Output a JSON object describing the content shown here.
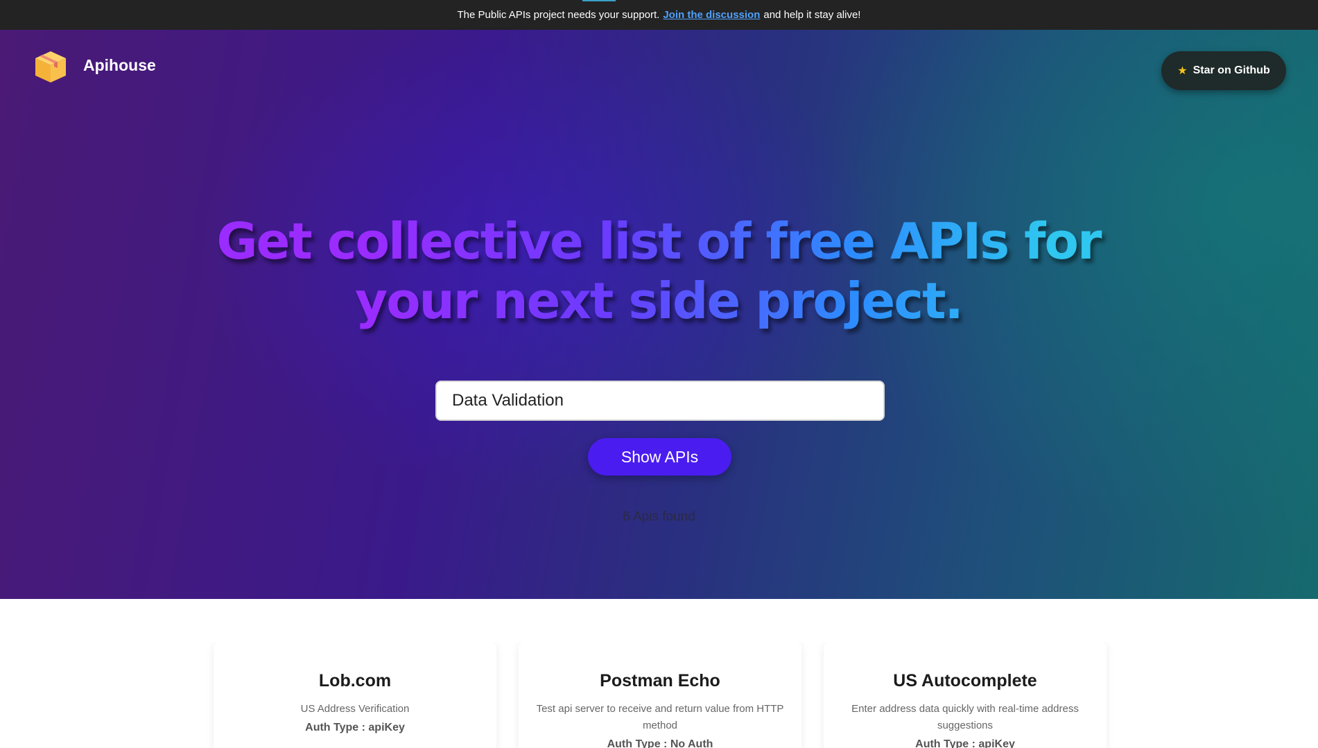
{
  "banner": {
    "text_before": "The Public APIs project needs your support.",
    "link": "Join the discussion",
    "text_after": "and help it stay alive!"
  },
  "header": {
    "brand": "Apihouse",
    "star_button": "Star on Github",
    "logo_icon": "package-box-icon",
    "star_icon": "star-icon"
  },
  "hero": {
    "headline_line1": "Get collective list of free APIs for",
    "headline_line2": "your next side project.",
    "search_value": "Data Validation",
    "show_button": "Show APIs",
    "results_count": "6 Apis found"
  },
  "cards": [
    {
      "title": "Lob.com",
      "description": "US Address Verification",
      "auth": "Auth Type : apiKey"
    },
    {
      "title": "Postman Echo",
      "description": "Test api server to receive and return value from HTTP method",
      "auth": "Auth Type : No Auth"
    },
    {
      "title": "US Autocomplete",
      "description": "Enter address data quickly with real-time address suggestions",
      "auth": "Auth Type : apiKey"
    }
  ],
  "colors": {
    "accent": "#4a1cf0",
    "banner_bg": "#232323",
    "link": "#4ea2ff"
  }
}
